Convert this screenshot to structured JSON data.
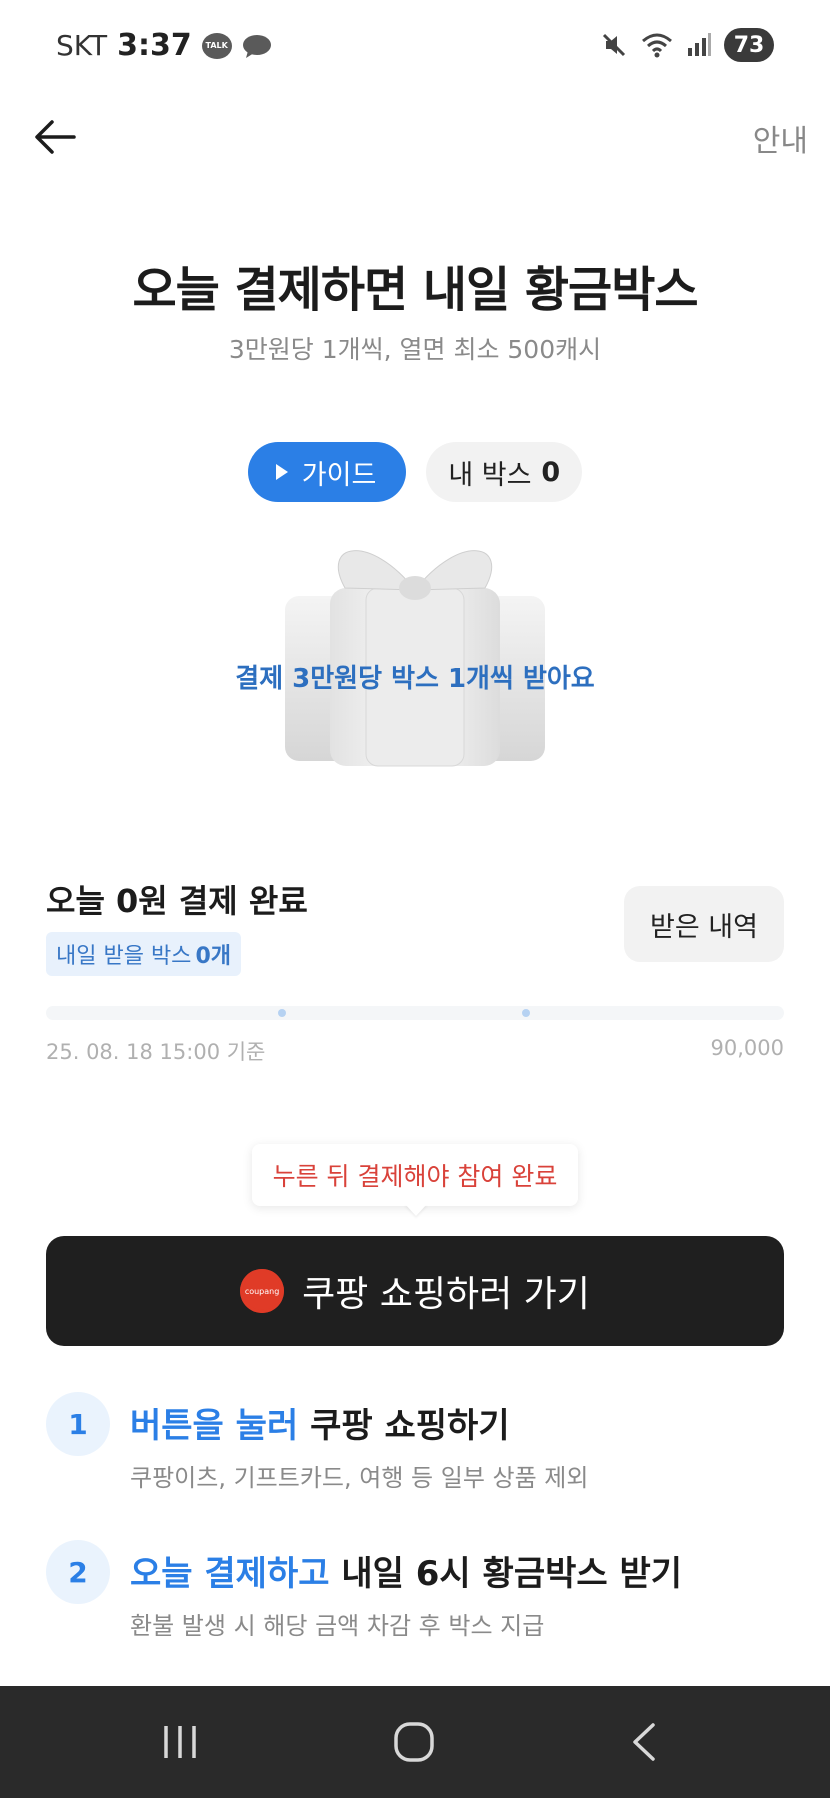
{
  "status_bar": {
    "carrier": "SKT",
    "time": "3:37",
    "talk_label": "TALK",
    "battery": "73"
  },
  "header": {
    "info_label": "안내"
  },
  "hero": {
    "title": "오늘 결제하면 내일 황금박스",
    "subtitle": "3만원당 1개씩, 열면 최소 500캐시",
    "guide_label": "가이드",
    "mybox_label": "내 박스",
    "mybox_count": "0",
    "gift_caption": "결제 3만원당 박스 1개씩 받아요"
  },
  "payment": {
    "title": "오늘 0원 결제 완료",
    "badge_label": "내일 받을 박스",
    "badge_count": "0개",
    "history_label": "받은 내역",
    "progress": 0,
    "date_label": "25. 08. 18 15:00 기준",
    "max_label": "90,000"
  },
  "tooltip": {
    "text": "누른 뒤 결제해야 참여 완료"
  },
  "cta": {
    "logo_text": "coupang",
    "label": "쿠팡 쇼핑하러 가기"
  },
  "steps": [
    {
      "num": "1",
      "highlight": "버튼을 눌러",
      "rest": " 쿠팡 쇼핑하기",
      "desc": "쿠팡이츠, 기프트카드, 여행 등 일부 상품 제외"
    },
    {
      "num": "2",
      "highlight": "오늘 결제하고",
      "rest": " 내일 6시 황금박스 받기",
      "desc": "환불 발생 시 해당 금액 차감 후 박스 지급"
    }
  ],
  "colors": {
    "accent": "#2b7fe6",
    "cta_bg": "#1f1f1f",
    "tooltip_text": "#d9423a"
  }
}
